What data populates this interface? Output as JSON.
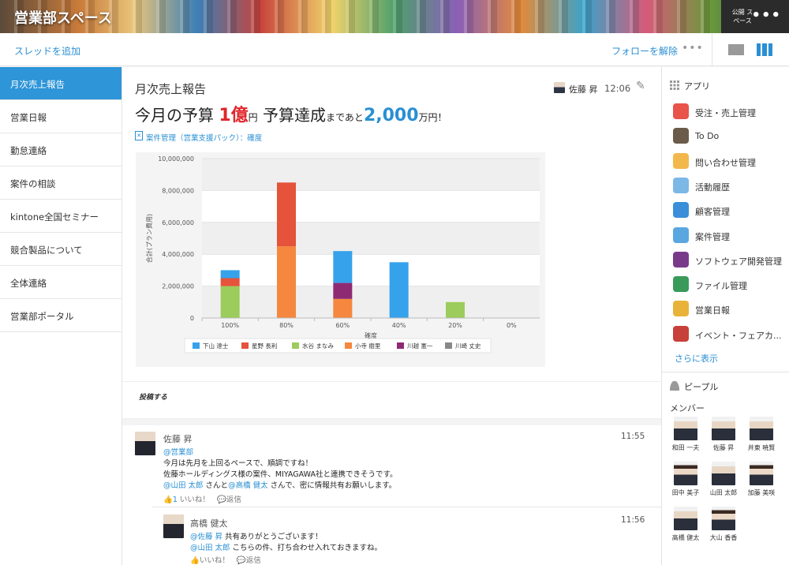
{
  "header": {
    "space_title": "営業部スペース",
    "public_label": "公開 スペース",
    "more": "•••"
  },
  "toolbar": {
    "add_thread": "スレッドを追加",
    "unfollow": "フォローを解除",
    "more": "•••"
  },
  "sidebar": {
    "items": [
      {
        "label": "月次売上報告",
        "active": true
      },
      {
        "label": "営業日報"
      },
      {
        "label": "勤怠連絡"
      },
      {
        "label": "案件の相談"
      },
      {
        "label": "kintone全国セミナー"
      },
      {
        "label": "競合製品について"
      },
      {
        "label": "全体連絡"
      },
      {
        "label": "営業部ポータル"
      }
    ]
  },
  "thread": {
    "title": "月次売上報告",
    "author": "佐藤 昇",
    "time": "12:06",
    "headline": {
      "p1": "今月の予算",
      "budget": "1億",
      "unit1": "円",
      "p2": "予算達成",
      "p3": "まであと",
      "remaining": "2,000",
      "unit2": "万円！"
    },
    "chart_link": "案件管理（営業支援パック）：確度"
  },
  "chart_data": {
    "type": "bar",
    "stacked": true,
    "categories": [
      "100%",
      "80%",
      "60%",
      "40%",
      "20%",
      "0%"
    ],
    "xlabel": "確度",
    "ylabel": "合計(プラン費用)",
    "ylim": [
      0,
      10000000
    ],
    "yticks": [
      "0",
      "2,000,000",
      "4,000,000",
      "6,000,000",
      "8,000,000",
      "10,000,000"
    ],
    "legend_position": "bottom",
    "series": [
      {
        "name": "下山 達士",
        "color": "#36a2eb",
        "values": [
          500000,
          0,
          2000000,
          3500000,
          0,
          0
        ]
      },
      {
        "name": "星野 長利",
        "color": "#e5533b",
        "values": [
          500000,
          4000000,
          0,
          0,
          0,
          0
        ]
      },
      {
        "name": "水谷 まなみ",
        "color": "#9ccc5b",
        "values": [
          2000000,
          0,
          0,
          0,
          1000000,
          0
        ]
      },
      {
        "name": "小寺 樹里",
        "color": "#f5873e",
        "values": [
          0,
          4500000,
          1200000,
          0,
          0,
          0
        ]
      },
      {
        "name": "川越 憲一",
        "color": "#8e2a73",
        "values": [
          0,
          0,
          1000000,
          0,
          0,
          0
        ]
      },
      {
        "name": "川崎 丈史",
        "color": "#888888",
        "values": [
          0,
          0,
          0,
          0,
          0,
          0
        ]
      }
    ]
  },
  "post": {
    "label": "投稿する"
  },
  "comments": [
    {
      "name": "佐藤 昇",
      "time": "11:55",
      "lines": [
        {
          "mention": "@営業部",
          "text": ""
        },
        {
          "mention": "",
          "text": "今月は先月を上回るペースで、順調ですね！"
        },
        {
          "mention": "",
          "text": "佐藤ホールディングス様の案件、MIYAGAWA社と連携できそうです。"
        },
        {
          "mention": "@山田 太郎",
          "text": " さんと",
          "mention2": "@高橋 健太",
          "text2": " さんで、密に情報共有お願いします。"
        }
      ],
      "like_count": "1",
      "like": "いいね！",
      "reply": "返信"
    },
    {
      "name": "高橋 健太",
      "time": "11:56",
      "lines": [
        {
          "mention": "@佐藤 昇",
          "text": " 共有ありがとうございます！"
        },
        {
          "mention": "@山田 太郎",
          "text": " こちらの件、打ち合わせ入れておきますね。"
        }
      ],
      "like": "いいね！",
      "reply": "返信"
    }
  ],
  "rightbar": {
    "apps_heading": "アプリ",
    "apps": [
      {
        "label": "受注・売上管理",
        "icon": "handshake-icon",
        "color": "#e8534a"
      },
      {
        "label": "To Do",
        "icon": "todo-icon",
        "color": "#6b5b4a"
      },
      {
        "label": "問い合わせ管理",
        "icon": "support-icon",
        "color": "#f2b84b"
      },
      {
        "label": "活動履歴",
        "icon": "activity-icon",
        "color": "#7bb8e6"
      },
      {
        "label": "顧客管理",
        "icon": "customer-icon",
        "color": "#3a8fd8"
      },
      {
        "label": "案件管理",
        "icon": "deal-icon",
        "color": "#5aa7e0"
      },
      {
        "label": "ソフトウェア開発管理",
        "icon": "dev-icon",
        "color": "#7a3a8a"
      },
      {
        "label": "ファイル管理",
        "icon": "file-icon",
        "color": "#3a9a5a"
      },
      {
        "label": "営業日報",
        "icon": "report-icon",
        "color": "#e9b33a"
      },
      {
        "label": "イベント・フェアカ...",
        "icon": "calendar-icon",
        "color": "#c8403a"
      }
    ],
    "show_more": "さらに表示",
    "people_heading": "ピープル",
    "members_heading": "メンバー",
    "members": [
      {
        "name": "和田 一夫",
        "female": false
      },
      {
        "name": "佐藤 昇",
        "female": false
      },
      {
        "name": "井東 暁賢",
        "female": false
      },
      {
        "name": "田中 美子",
        "female": true
      },
      {
        "name": "山田 太郎",
        "female": false
      },
      {
        "name": "加藤 美咲",
        "female": true
      },
      {
        "name": "高橋 健太",
        "female": false
      },
      {
        "name": "大山 香香",
        "female": true
      }
    ]
  }
}
